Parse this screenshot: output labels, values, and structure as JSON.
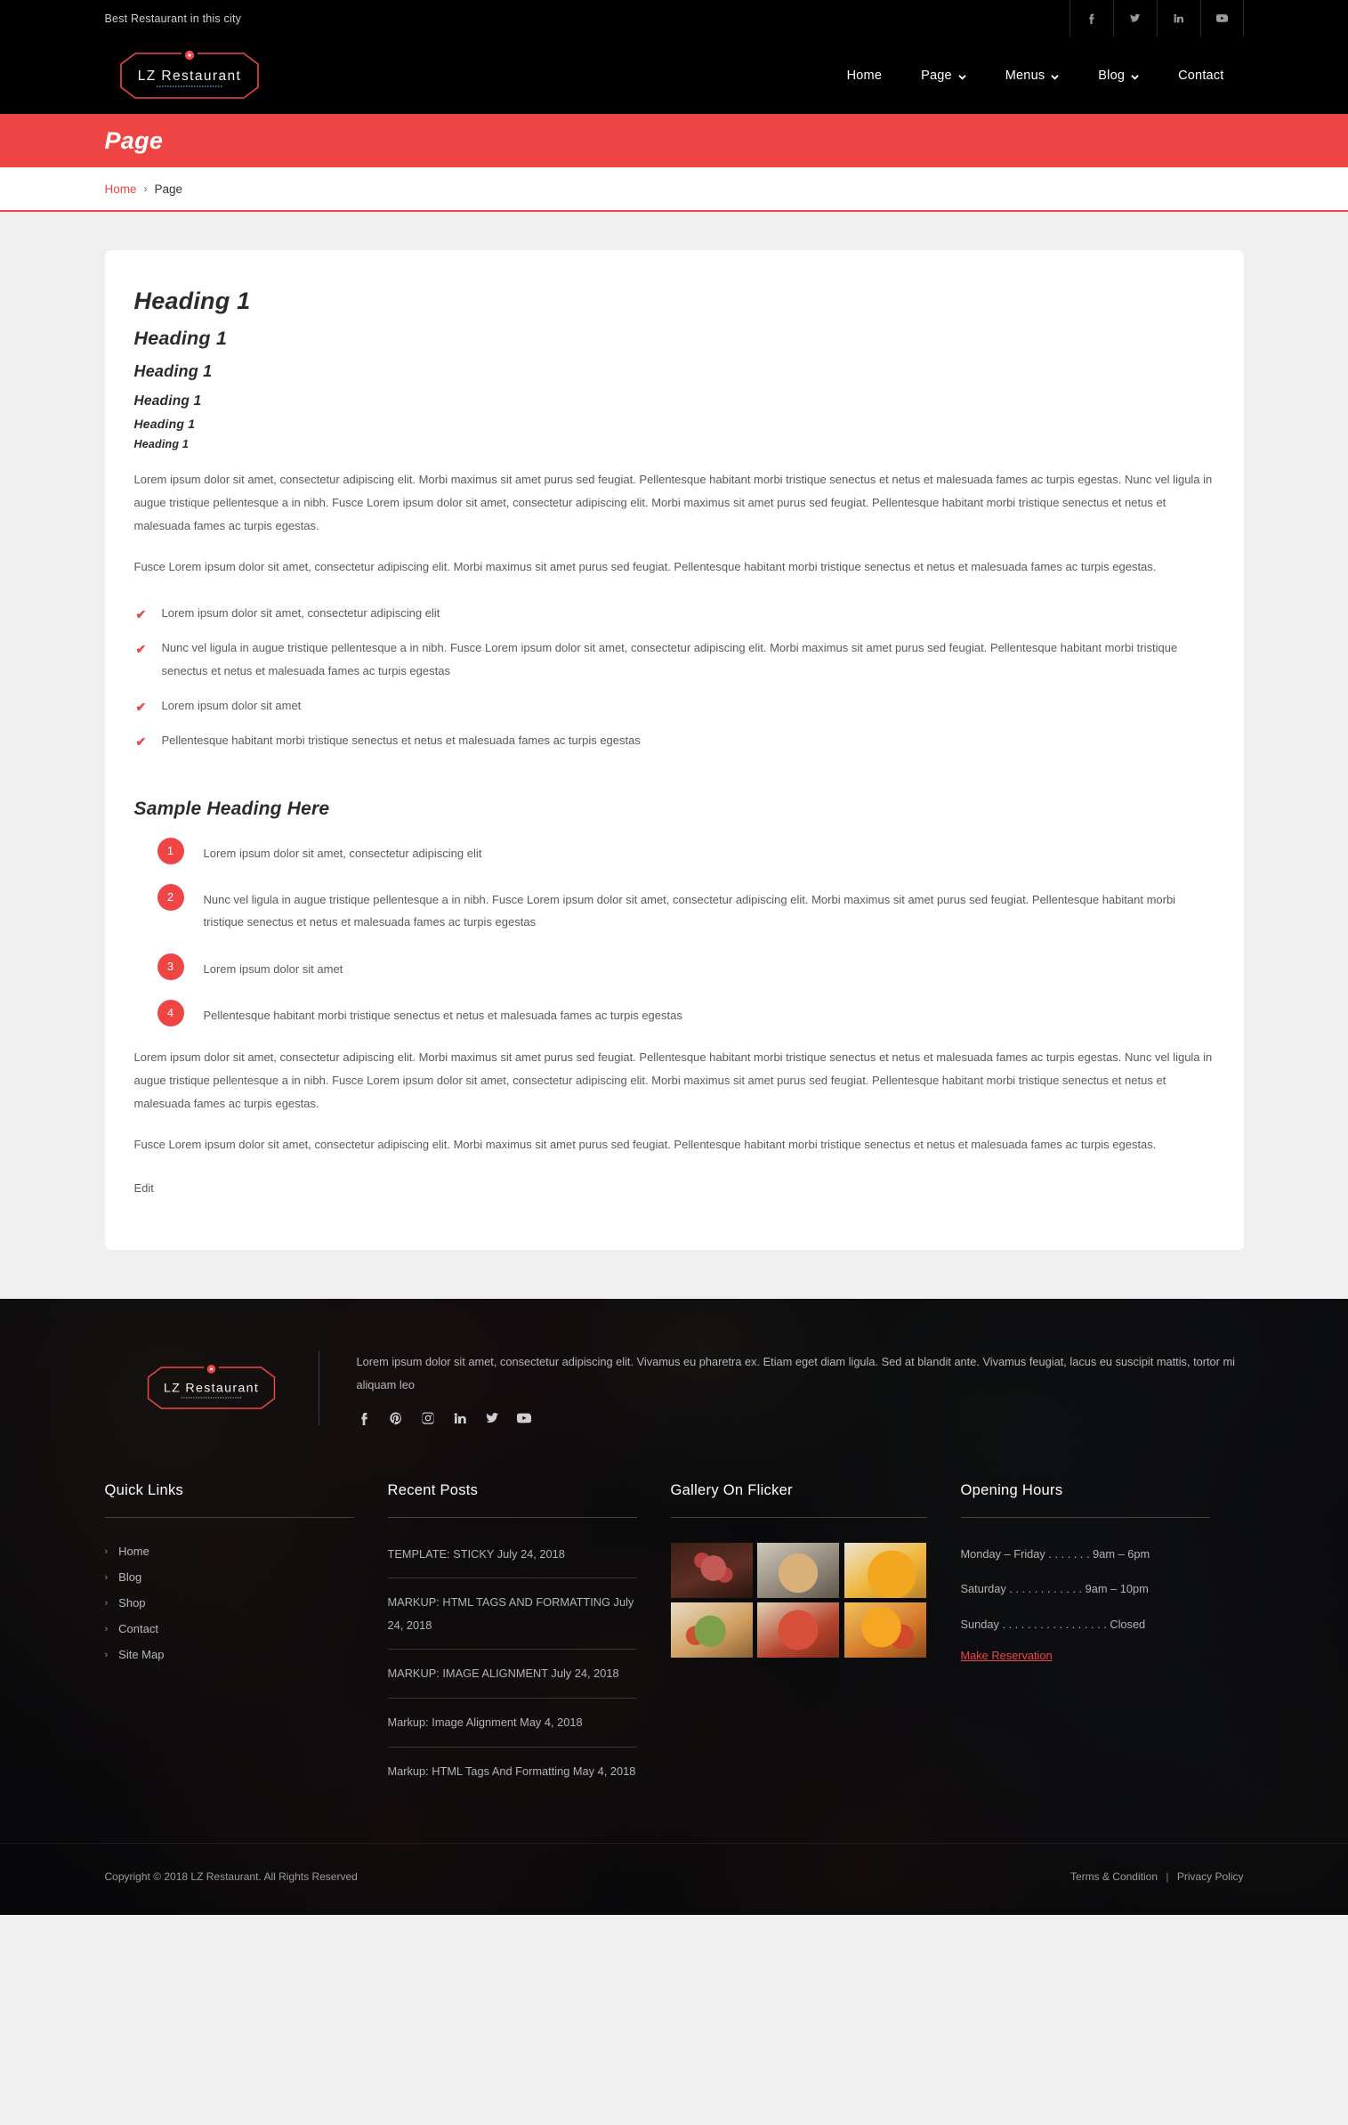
{
  "topbar": {
    "tagline": "Best Restaurant in this city",
    "social": [
      {
        "name": "facebook-icon",
        "label": "Facebook"
      },
      {
        "name": "twitter-icon",
        "label": "Twitter"
      },
      {
        "name": "linkedin-icon",
        "label": "LinkedIn"
      },
      {
        "name": "youtube-icon",
        "label": "YouTube"
      }
    ]
  },
  "header": {
    "logo_text": "LZ Restaurant",
    "nav": [
      {
        "label": "Home",
        "has_dropdown": false
      },
      {
        "label": "Page",
        "has_dropdown": true
      },
      {
        "label": "Menus",
        "has_dropdown": true
      },
      {
        "label": "Blog",
        "has_dropdown": true
      },
      {
        "label": "Contact",
        "has_dropdown": false
      }
    ]
  },
  "banner": {
    "title": "Page"
  },
  "breadcrumb": {
    "home": "Home",
    "separator": "›",
    "current": "Page"
  },
  "content": {
    "headings": [
      "Heading 1",
      "Heading 1",
      "Heading 1",
      "Heading 1",
      "Heading 1",
      "Heading 1"
    ],
    "paragraph_1": "Lorem ipsum dolor sit amet, consectetur adipiscing elit. Morbi maximus sit amet purus sed feugiat. Pellentesque habitant morbi tristique senectus et netus et malesuada fames ac turpis egestas. Nunc vel ligula in augue tristique pellentesque a in nibh. Fusce Lorem ipsum dolor sit amet, consectetur adipiscing elit. Morbi maximus sit amet purus sed feugiat. Pellentesque habitant morbi tristique senectus et netus et malesuada fames ac turpis egestas.",
    "paragraph_2": "Fusce Lorem ipsum dolor sit amet, consectetur adipiscing elit. Morbi maximus sit amet purus sed feugiat. Pellentesque habitant morbi tristique senectus et netus et malesuada fames ac turpis egestas.",
    "check_list": [
      "Lorem ipsum dolor sit amet, consectetur adipiscing elit",
      "Nunc vel ligula in augue tristique pellentesque a in nibh. Fusce Lorem ipsum dolor sit amet, consectetur adipiscing elit. Morbi maximus sit amet purus sed feugiat. Pellentesque habitant morbi tristique senectus et netus et malesuada fames ac turpis egestas",
      "Lorem ipsum dolor sit amet",
      "Pellentesque habitant morbi tristique senectus et netus et malesuada fames ac turpis egestas"
    ],
    "sample_heading": "Sample Heading Here",
    "numbered_list": [
      {
        "number": "1",
        "text": "Lorem ipsum dolor sit amet, consectetur adipiscing elit"
      },
      {
        "number": "2",
        "text": "Nunc vel ligula in augue tristique pellentesque a in nibh. Fusce Lorem ipsum dolor sit amet, consectetur adipiscing elit. Morbi maximus sit amet purus sed feugiat. Pellentesque habitant morbi tristique senectus et netus et malesuada fames ac turpis egestas"
      },
      {
        "number": "3",
        "text": "Lorem ipsum dolor sit amet"
      },
      {
        "number": "4",
        "text": "Pellentesque habitant morbi tristique senectus et netus et malesuada fames ac turpis egestas"
      }
    ],
    "paragraph_3": "Lorem ipsum dolor sit amet, consectetur adipiscing elit. Morbi maximus sit amet purus sed feugiat. Pellentesque habitant morbi tristique senectus et netus et malesuada fames ac turpis egestas. Nunc vel ligula in augue tristique pellentesque a in nibh. Fusce Lorem ipsum dolor sit amet, consectetur adipiscing elit. Morbi maximus sit amet purus sed feugiat. Pellentesque habitant morbi tristique senectus et netus et malesuada fames ac turpis egestas.",
    "paragraph_4": "Fusce Lorem ipsum dolor sit amet, consectetur adipiscing elit. Morbi maximus sit amet purus sed feugiat. Pellentesque habitant morbi tristique senectus et netus et malesuada fames ac turpis egestas.",
    "edit_link": "Edit"
  },
  "footer": {
    "logo_text": "LZ Restaurant",
    "about": "Lorem ipsum dolor sit amet, consectetur adipiscing elit. Vivamus eu pharetra ex. Etiam eget diam ligula. Sed at blandit ante. Vivamus feugiat, lacus eu suscipit mattis, tortor mi aliquam leo",
    "social": [
      {
        "name": "facebook-icon",
        "label": "Facebook"
      },
      {
        "name": "pinterest-icon",
        "label": "Pinterest"
      },
      {
        "name": "instagram-icon",
        "label": "Instagram"
      },
      {
        "name": "linkedin-icon",
        "label": "LinkedIn"
      },
      {
        "name": "twitter-icon",
        "label": "Twitter"
      },
      {
        "name": "youtube-icon",
        "label": "YouTube"
      }
    ],
    "quick_links": {
      "title": "Quick Links",
      "items": [
        "Home",
        "Blog",
        "Shop",
        "Contact",
        "Site Map"
      ]
    },
    "recent_posts": {
      "title": "Recent Posts",
      "items": [
        "TEMPLATE: STICKY July 24, 2018",
        "MARKUP: HTML TAGS AND FORMATTING July 24, 2018",
        "MARKUP: IMAGE ALIGNMENT July 24, 2018",
        "Markup: Image Alignment May 4, 2018",
        "Markup: HTML Tags And Formatting May 4, 2018"
      ]
    },
    "gallery": {
      "title": "Gallery On Flicker",
      "items": [
        "raspberry-smoothie-photo",
        "clam-soup-bowl-photo",
        "pumpkin-soup-photo",
        "veggie-flatbread-photo",
        "margherita-pizza-photo",
        "paneer-salad-photo"
      ]
    },
    "opening_hours": {
      "title": "Opening Hours",
      "rows": [
        "Monday – Friday . . . . . . . 9am – 6pm",
        "Saturday . . . . . . . . . . . . 9am – 10pm",
        "Sunday . . . . . . . . . . . . . . . . . Closed"
      ],
      "reserve_label": "Make Reservation"
    },
    "copyright": "Copyright © 2018 LZ Restaurant. All Rights Reserved",
    "terms": "Terms & Condition",
    "separator": "|",
    "privacy": "Privacy Policy"
  },
  "colors": {
    "accent": "#ef4545",
    "dark": "#000000",
    "page_bg": "#efefef"
  }
}
